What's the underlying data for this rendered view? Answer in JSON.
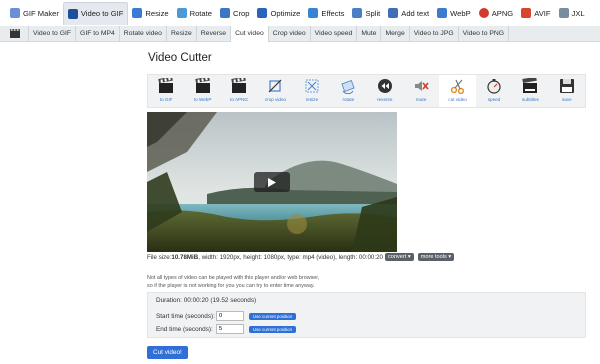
{
  "top_menu": {
    "items": [
      {
        "label": "GIF Maker",
        "icon": "gif-maker-icon"
      },
      {
        "label": "Video to GIF",
        "icon": "video-to-gif-icon"
      },
      {
        "label": "Resize",
        "icon": "resize-icon"
      },
      {
        "label": "Rotate",
        "icon": "rotate-icon"
      },
      {
        "label": "Crop",
        "icon": "crop-icon"
      },
      {
        "label": "Optimize",
        "icon": "optimize-icon"
      },
      {
        "label": "Effects",
        "icon": "effects-icon"
      },
      {
        "label": "Split",
        "icon": "split-icon"
      },
      {
        "label": "Add text",
        "icon": "add-text-icon"
      },
      {
        "label": "WebP",
        "icon": "webp-icon"
      },
      {
        "label": "APNG",
        "icon": "apng-icon"
      },
      {
        "label": "AVIF",
        "icon": "avif-icon"
      },
      {
        "label": "JXL",
        "icon": "jxl-icon"
      }
    ]
  },
  "sub_menu": {
    "tabs": [
      "Video to GIF",
      "GIF to MP4",
      "Rotate video",
      "Resize",
      "Reverse",
      "Cut video",
      "Crop video",
      "Video speed",
      "Mute",
      "Merge",
      "Video to JPG",
      "Video to PNG"
    ]
  },
  "page": {
    "title": "Video Cutter"
  },
  "tools": {
    "items": [
      {
        "label": "to GIF",
        "icon": "clapperboard-icon"
      },
      {
        "label": "to WebP",
        "icon": "clapperboard-icon"
      },
      {
        "label": "to APNG",
        "icon": "clapperboard-icon"
      },
      {
        "label": "crop video",
        "icon": "crop-video-icon"
      },
      {
        "label": "resize",
        "icon": "resize-video-icon"
      },
      {
        "label": "rotate",
        "icon": "rotate-video-icon"
      },
      {
        "label": "reverse",
        "icon": "reverse-icon"
      },
      {
        "label": "mute",
        "icon": "mute-icon"
      },
      {
        "label": "cut video",
        "icon": "scissors-icon"
      },
      {
        "label": "speed",
        "icon": "speed-icon"
      },
      {
        "label": "subtitles",
        "icon": "subtitles-icon"
      },
      {
        "label": "save",
        "icon": "save-icon"
      }
    ]
  },
  "file_info": {
    "prefix": "File size: ",
    "size": "10.78MiB",
    "details": ", width: 1920px, height: 1080px, type: mp4 (video), length: 00:00:20",
    "convert_label": "convert ▾",
    "more_tools_label": "more tools ▾"
  },
  "note": {
    "line1": "Not all types of video can be played with this player and/or web browser,",
    "line2": "so if the player is not working for you you can try to enter time anyway."
  },
  "cutter": {
    "duration": "Duration: 00:00:20 (19.52 seconds)",
    "start_label": "Start time (seconds):",
    "start_value": "0",
    "end_label": "End time (seconds):",
    "end_value": "5",
    "use_position_label": "Use current position",
    "submit_label": "Cut video!"
  }
}
